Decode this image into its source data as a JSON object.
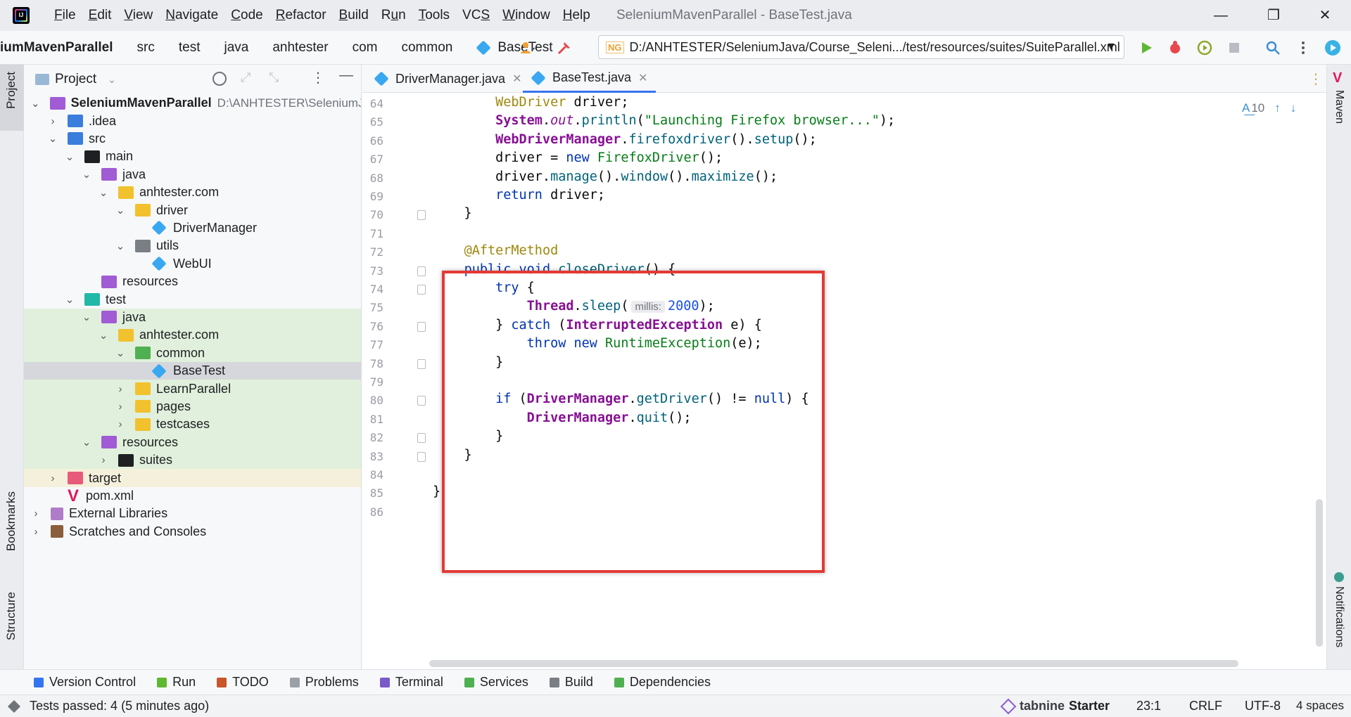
{
  "titlebar": {
    "menu": [
      {
        "pre": "",
        "u": "F",
        "post": "ile"
      },
      {
        "pre": "",
        "u": "E",
        "post": "dit"
      },
      {
        "pre": "",
        "u": "V",
        "post": "iew"
      },
      {
        "pre": "",
        "u": "N",
        "post": "avigate"
      },
      {
        "pre": "",
        "u": "C",
        "post": "ode"
      },
      {
        "pre": "",
        "u": "R",
        "post": "efactor"
      },
      {
        "pre": "",
        "u": "B",
        "post": "uild"
      },
      {
        "pre": "R",
        "u": "u",
        "post": "n"
      },
      {
        "pre": "",
        "u": "T",
        "post": "ools"
      },
      {
        "pre": "VC",
        "u": "S",
        "post": ""
      },
      {
        "pre": "",
        "u": "W",
        "post": "indow"
      },
      {
        "pre": "",
        "u": "H",
        "post": "elp"
      }
    ],
    "window_title": "SeleniumMavenParallel - BaseTest.java",
    "minimize": "—",
    "restore": "❐",
    "close": "✕"
  },
  "navbar": {
    "crumbs": [
      "iumMavenParallel",
      "src",
      "test",
      "java",
      "anhtester",
      "com",
      "common",
      "BaseTest"
    ],
    "run_config": "D:/ANHTESTER/SeleniumJava/Course_Seleni.../test/resources/suites/SuiteParallel.xml"
  },
  "left_strip": {
    "project": "Project",
    "bookmarks": "Bookmarks",
    "structure": "Structure"
  },
  "project": {
    "title": "Project",
    "tree": [
      {
        "label": "SeleniumMavenParallel",
        "hint": "D:\\ANHTESTER\\SeleniumJ",
        "depth": 0,
        "open": true,
        "icon": "module-folder",
        "bold": true
      },
      {
        "label": ".idea",
        "depth": 1,
        "open": false,
        "icon": "idea-folder"
      },
      {
        "label": "src",
        "depth": 1,
        "open": true,
        "icon": "src-folder"
      },
      {
        "label": "main",
        "depth": 2,
        "open": true,
        "icon": "folder"
      },
      {
        "label": "java",
        "depth": 3,
        "open": true,
        "icon": "source-folder"
      },
      {
        "label": "anhtester.com",
        "depth": 4,
        "open": true,
        "icon": "package-folder"
      },
      {
        "label": "driver",
        "depth": 5,
        "open": true,
        "icon": "package-folder"
      },
      {
        "label": "DriverManager",
        "depth": 6,
        "icon": "class"
      },
      {
        "label": "utils",
        "depth": 5,
        "open": true,
        "icon": "gray-folder"
      },
      {
        "label": "WebUI",
        "depth": 6,
        "icon": "class"
      },
      {
        "label": "resources",
        "depth": 3,
        "icon": "resources-folder"
      },
      {
        "label": "test",
        "depth": 2,
        "open": true,
        "icon": "test-folder"
      },
      {
        "label": "java",
        "depth": 3,
        "open": true,
        "icon": "source-folder",
        "bg": "green"
      },
      {
        "label": "anhtester.com",
        "depth": 4,
        "open": true,
        "icon": "package-folder",
        "bg": "green"
      },
      {
        "label": "common",
        "depth": 5,
        "open": true,
        "icon": "green-folder",
        "bg": "green"
      },
      {
        "label": "BaseTest",
        "depth": 6,
        "icon": "class",
        "bg": "sel"
      },
      {
        "label": "LearnParallel",
        "depth": 5,
        "open": false,
        "icon": "package-folder",
        "bg": "green"
      },
      {
        "label": "pages",
        "depth": 5,
        "open": false,
        "icon": "package-folder",
        "bg": "green"
      },
      {
        "label": "testcases",
        "depth": 5,
        "open": false,
        "icon": "package-folder",
        "bg": "green"
      },
      {
        "label": "resources",
        "depth": 3,
        "open": true,
        "icon": "resources-folder",
        "bg": "green"
      },
      {
        "label": "suites",
        "depth": 4,
        "open": false,
        "icon": "folder",
        "bg": "green"
      },
      {
        "label": "target",
        "depth": 1,
        "open": false,
        "icon": "red-folder",
        "bg": "yellow"
      },
      {
        "label": "pom.xml",
        "depth": 1,
        "icon": "maven"
      },
      {
        "label": "External Libraries",
        "depth": 0,
        "open": false,
        "icon": "library"
      },
      {
        "label": "Scratches and Consoles",
        "depth": 0,
        "open": false,
        "icon": "scratch"
      }
    ]
  },
  "editor": {
    "tabs": [
      {
        "label": "DriverManager.java",
        "active": false
      },
      {
        "label": "BaseTest.java",
        "active": true
      }
    ],
    "inspection_count": "10",
    "lines": [
      {
        "n": "64",
        "html": "        <span class='cls2' style='font-weight:normal;color:#9e880d'>WebDriver</span> driver;"
      },
      {
        "n": "65",
        "html": "        <span class='cls2'>System</span>.<span class='it'>out</span>.<span class='mth'>println</span>(<span class='str'>\"Launching Firefox browser...\"</span>);"
      },
      {
        "n": "66",
        "html": "        <span class='cls2'>WebDriverManager</span>.<span class='dm'>firefoxdriver</span>().<span class='dm'>setup</span>();"
      },
      {
        "n": "67",
        "html": "        driver = <span class='kw'>new</span> <span class='cls3'>FirefoxDriver</span>();"
      },
      {
        "n": "68",
        "html": "        driver.<span class='dm'>manage</span>().<span class='dm'>window</span>().<span class='dm'>maximize</span>();"
      },
      {
        "n": "69",
        "html": "        <span class='kw'>return</span> driver;"
      },
      {
        "n": "70",
        "html": "    }"
      },
      {
        "n": "71",
        "html": ""
      },
      {
        "n": "72",
        "html": "    <span class='ann'>@AfterMethod</span>"
      },
      {
        "n": "73",
        "html": "    <span class='kw'>public void</span> <span class='mth'>closeDriver</span>() {"
      },
      {
        "n": "74",
        "html": "        <span class='kw'>try</span> {"
      },
      {
        "n": "75",
        "html": "            <span class='cls2'>Thread</span>.<span class='mth'>sleep</span>(<span class='hint'>millis:</span><span class='num'>2000</span>);"
      },
      {
        "n": "76",
        "html": "        } <span class='kw'>catch</span> (<span class='cls2'>InterruptedException</span> e) {"
      },
      {
        "n": "77",
        "html": "            <span class='kw'>throw new</span> <span class='cls3'>RuntimeException</span>(e);"
      },
      {
        "n": "78",
        "html": "        }"
      },
      {
        "n": "79",
        "html": ""
      },
      {
        "n": "80",
        "html": "        <span class='kw'>if</span> (<span class='cls2'>DriverManager</span>.<span class='mth'>getDriver</span>() != <span class='kw'>null</span>) {"
      },
      {
        "n": "81",
        "html": "            <span class='cls2'>DriverManager</span>.<span class='mth'>quit</span>();"
      },
      {
        "n": "82",
        "html": "        }"
      },
      {
        "n": "83",
        "html": "    }"
      },
      {
        "n": "84",
        "html": ""
      },
      {
        "n": "85",
        "html": "}"
      },
      {
        "n": "86",
        "html": ""
      }
    ]
  },
  "right_strip": {
    "maven": "Maven",
    "notifications": "Notifications"
  },
  "bottom_tools": [
    {
      "label": "Version Control",
      "icon": "version-control-icon",
      "color": "#3574f0"
    },
    {
      "label": "Run",
      "icon": "run-icon",
      "color": "#5fb832"
    },
    {
      "label": "TODO",
      "icon": "todo-icon",
      "color": "#c9552b"
    },
    {
      "label": "Problems",
      "icon": "problems-icon",
      "color": "#9aa0a6"
    },
    {
      "label": "Terminal",
      "icon": "terminal-icon",
      "color": "#7a5ac8"
    },
    {
      "label": "Services",
      "icon": "services-icon",
      "color": "#4fb051"
    },
    {
      "label": "Build",
      "icon": "build-icon",
      "color": "#7a7e85"
    },
    {
      "label": "Dependencies",
      "icon": "dependencies-icon",
      "color": "#4fb051"
    }
  ],
  "status": {
    "message": "Tests passed: 4 (5 minutes ago)",
    "tabnine_brand": "tabnine",
    "tabnine_tier": "Starter",
    "position": "23:1",
    "line_ending": "CRLF",
    "encoding": "UTF-8",
    "indent": "4 spaces"
  }
}
